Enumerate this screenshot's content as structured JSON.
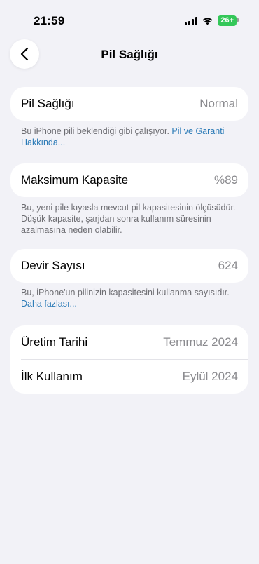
{
  "status_bar": {
    "time": "21:59",
    "battery_level": "26+"
  },
  "nav": {
    "title": "Pil Sağlığı"
  },
  "battery_health": {
    "label": "Pil Sağlığı",
    "value": "Normal",
    "note": "Bu iPhone pili beklendiği gibi çalışıyor.",
    "link": "Pil ve Garanti Hakkında..."
  },
  "max_capacity": {
    "label": "Maksimum Kapasite",
    "value": "%89",
    "note": "Bu, yeni pile kıyasla mevcut pil kapasitesinin ölçüsüdür. Düşük kapasite, şarjdan sonra kullanım süresinin azalmasına neden olabilir."
  },
  "cycle_count": {
    "label": "Devir Sayısı",
    "value": "624",
    "note": "Bu, iPhone'un pilinizin kapasitesini kullanma sayısıdır.",
    "link": "Daha fazlası..."
  },
  "dates": {
    "manufacture_label": "Üretim Tarihi",
    "manufacture_value": "Temmuz 2024",
    "first_use_label": "İlk Kullanım",
    "first_use_value": "Eylül 2024"
  },
  "colors": {
    "background": "#f2f2f7",
    "link": "#2a7ab6",
    "battery": "#34c759"
  }
}
